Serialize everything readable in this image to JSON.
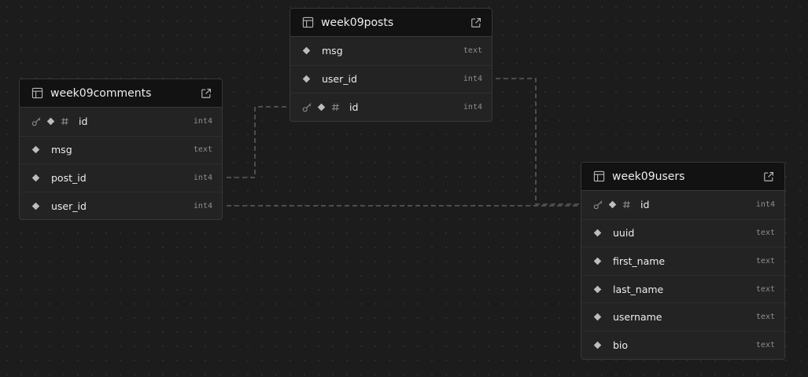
{
  "tables": {
    "comments": {
      "name": "week09comments",
      "columns": [
        {
          "name": "id",
          "type": "int4",
          "primary_key": true
        },
        {
          "name": "msg",
          "type": "text",
          "primary_key": false
        },
        {
          "name": "post_id",
          "type": "int4",
          "primary_key": false
        },
        {
          "name": "user_id",
          "type": "int4",
          "primary_key": false
        }
      ]
    },
    "posts": {
      "name": "week09posts",
      "columns": [
        {
          "name": "msg",
          "type": "text",
          "primary_key": false
        },
        {
          "name": "user_id",
          "type": "int4",
          "primary_key": false
        },
        {
          "name": "id",
          "type": "int4",
          "primary_key": true
        }
      ]
    },
    "users": {
      "name": "week09users",
      "columns": [
        {
          "name": "id",
          "type": "int4",
          "primary_key": true
        },
        {
          "name": "uuid",
          "type": "text",
          "primary_key": false
        },
        {
          "name": "first_name",
          "type": "text",
          "primary_key": false
        },
        {
          "name": "last_name",
          "type": "text",
          "primary_key": false
        },
        {
          "name": "username",
          "type": "text",
          "primary_key": false
        },
        {
          "name": "bio",
          "type": "text",
          "primary_key": false
        }
      ]
    }
  },
  "relations": [
    {
      "from": "week09comments.post_id",
      "to": "week09posts.id"
    },
    {
      "from": "week09comments.user_id",
      "to": "week09users.id"
    },
    {
      "from": "week09posts.user_id",
      "to": "week09users.id"
    }
  ],
  "colors": {
    "background": "#1c1c1c",
    "header": "#121212",
    "row": "#232323",
    "text": "#ededed",
    "type_text": "#8f8f8f",
    "edge": "#6a6a6a"
  },
  "icons": {
    "table": "table-grid-icon",
    "open": "external-link-icon",
    "primary_key": "key-icon",
    "nullable": "diamond-icon",
    "identity": "hash-icon"
  }
}
